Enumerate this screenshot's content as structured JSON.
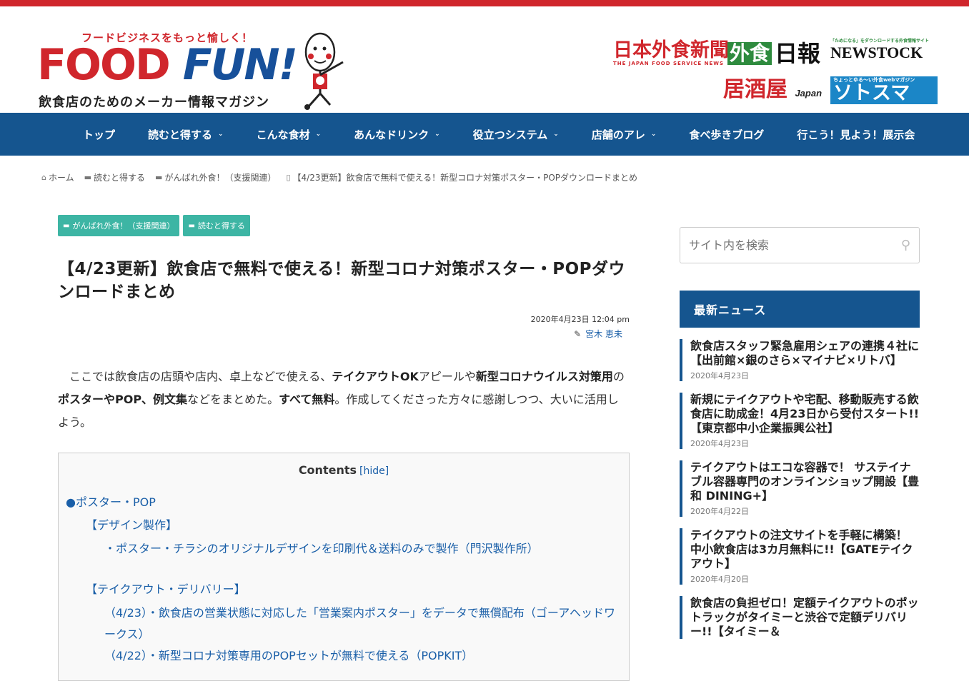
{
  "header": {
    "tagline": "フードビジネスをもっと愉しく！",
    "logo_food": "FOOD",
    "logo_fun": "FUN!",
    "logo_sub": "飲食店のためのメーカー情報マガジン",
    "partners": {
      "p1": "日本外食新聞",
      "p1_sub": "THE JAPAN FOOD SERVICE NEWS",
      "p2": "外食",
      "p3": "日報",
      "p4_sub": "「ためになる」をダウンロードする外食情報サイト",
      "p4": "NEWSTOCK",
      "p5": "居酒屋",
      "p5_jp": "Japan",
      "p6_sub": "ちょっとゆる〜い外食webマガジン",
      "p6": "ソトスマ"
    }
  },
  "nav": {
    "items": [
      {
        "label": "トップ",
        "has_sub": false
      },
      {
        "label": "読むと得する",
        "has_sub": true
      },
      {
        "label": "こんな食材",
        "has_sub": true
      },
      {
        "label": "あんなドリンク",
        "has_sub": true
      },
      {
        "label": "役立つシステム",
        "has_sub": true
      },
      {
        "label": "店舗のアレ",
        "has_sub": true
      },
      {
        "label": "食べ歩きブログ",
        "has_sub": false
      },
      {
        "label": "行こう！見よう！展示会",
        "has_sub": false
      }
    ],
    "chev": "⌄"
  },
  "breadcrumb": {
    "home": "ホーム",
    "c1": "読むと得する",
    "c2": "がんばれ外食！（支援関連）",
    "current": "【4/23更新】飲食店で無料で使える！新型コロナ対策ポスター・POPダウンロードまとめ"
  },
  "article": {
    "cat1": "がんばれ外食！（支援関連）",
    "cat2": "読むと得する",
    "title": "【4/23更新】飲食店で無料で使える！新型コロナ対策ポスター・POPダウンロードまとめ",
    "date": "2020年4月23日 12:04 pm",
    "author": "宮木 恵未",
    "lead_1": "ここでは飲食店の店頭や店内、卓上などで使える、",
    "lead_b1": "テイクアウトOK",
    "lead_2": "アピールや",
    "lead_b2": "新型コロナウイルス対策用",
    "lead_3": "の",
    "lead_b3": "ポスターやPOP、例文集",
    "lead_4": "などをまとめた。",
    "lead_b4": "すべて無料",
    "lead_5": "。作成してくださった方々に感謝しつつ、大いに活用しよう。"
  },
  "toc": {
    "heading": "Contents",
    "hide": "[hide]",
    "s1": "●ポスター・POP",
    "s1a": "【デザイン製作】",
    "s1a1": "・ポスター・チラシのオリジナルデザインを印刷代＆送料のみで製作（門沢製作所）",
    "s1b": "【テイクアウト・デリバリー】",
    "s1b1": "（4/23）・飲食店の営業状態に対応した「営業案内ポスター」をデータで無償配布（ゴーアヘッドワークス）",
    "s1b2": "（4/22）・新型コロナ対策専用のPOPセットが無料で使える（POPKIT）"
  },
  "sidebar": {
    "search_placeholder": "サイト内を検索",
    "news_heading": "最新ニュース",
    "news": [
      {
        "title": "飲食店スタッフ緊急雇用シェアの連携４社に【出前館×銀のさら×マイナビ×リトバ】",
        "date": "2020年4月23日"
      },
      {
        "title": "新規にテイクアウトや宅配、移動販売する飲食店に助成金！4月23日から受付スタート!!【東京都中小企業振興公社】",
        "date": "2020年4月23日"
      },
      {
        "title": "テイクアウトはエコな容器で！ サステイナブル容器専門のオンラインショップ開設【豊和 DINING+】",
        "date": "2020年4月22日"
      },
      {
        "title": "テイクアウトの注文サイトを手軽に構築！ 中小飲食店は3カ月無料に!!【GATEテイクアウト】",
        "date": "2020年4月20日"
      },
      {
        "title": "飲食店の負担ゼロ！定額テイクアウトのポットラックがタイミーと渋谷で定額デリバリー!!【タイミー＆",
        "date": ""
      }
    ]
  },
  "colors": {
    "brand_red": "#d0262c",
    "brand_blue": "#15558f",
    "cat_teal": "#3db5a4",
    "link": "#1a5fa8"
  }
}
